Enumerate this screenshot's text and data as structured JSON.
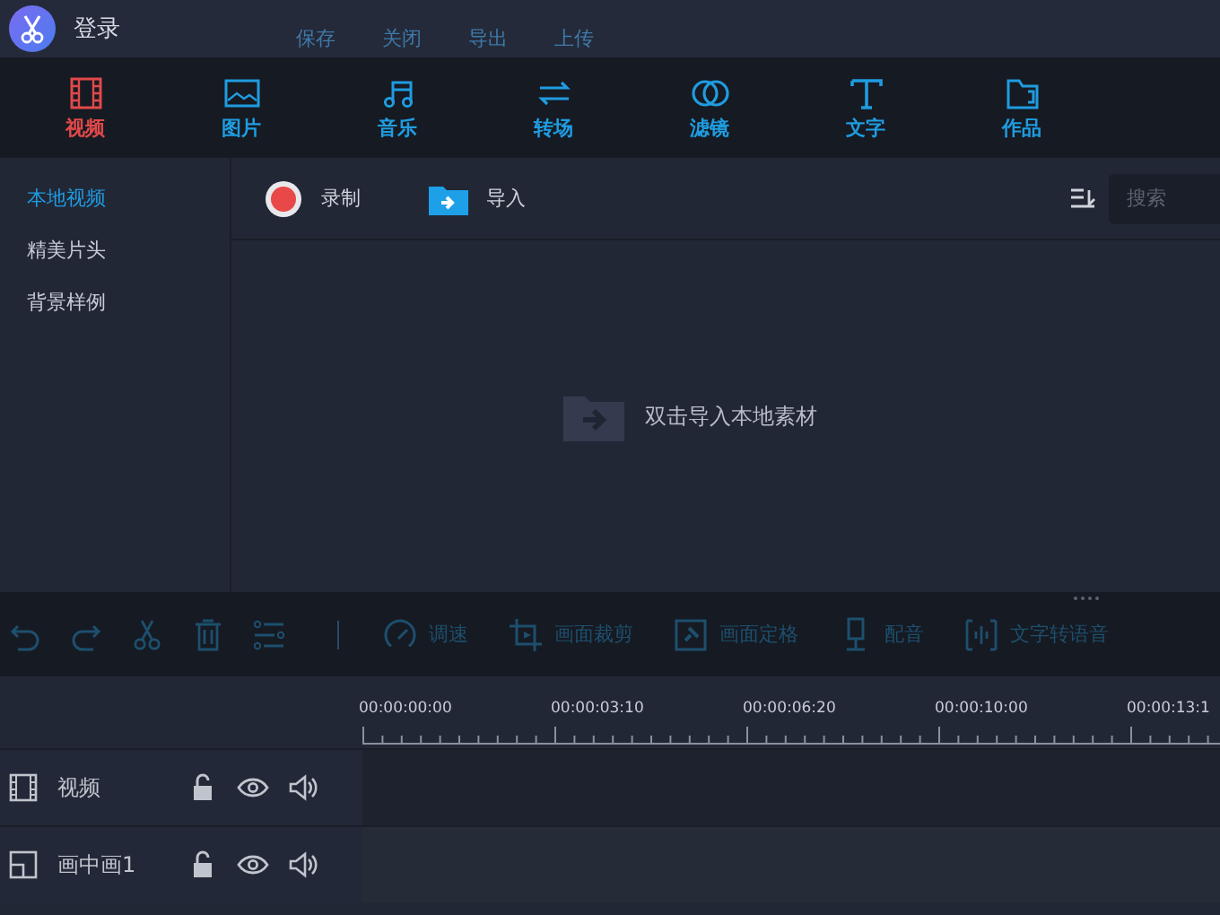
{
  "title_bar": {
    "login": "登录",
    "menu": [
      {
        "label": "保存",
        "disabled": true
      },
      {
        "label": "关闭",
        "disabled": true
      },
      {
        "label": "导出",
        "disabled": true
      },
      {
        "label": "上传",
        "disabled": true
      }
    ]
  },
  "tabs": [
    {
      "label": "视频",
      "kind": "film",
      "selected": true
    },
    {
      "label": "图片",
      "kind": "image",
      "selected": false
    },
    {
      "label": "音乐",
      "kind": "music",
      "selected": false
    },
    {
      "label": "转场",
      "kind": "swap",
      "selected": false
    },
    {
      "label": "滤镜",
      "kind": "rings",
      "selected": false
    },
    {
      "label": "文字",
      "kind": "text",
      "selected": false
    },
    {
      "label": "作品",
      "kind": "folder",
      "selected": false
    }
  ],
  "sidebar": {
    "items": [
      {
        "label": "本地视频",
        "selected": true
      },
      {
        "label": "精美片头",
        "selected": false
      },
      {
        "label": "背景样例",
        "selected": false
      }
    ]
  },
  "media_toolbar": {
    "record": "录制",
    "import": "导入",
    "search": {
      "placeholder": "搜索"
    }
  },
  "empty_hint": "双击导入本地素材",
  "edit_toolbar": [
    {
      "kind": "undo",
      "disabled": true
    },
    {
      "kind": "redo",
      "disabled": true
    },
    {
      "kind": "cut",
      "disabled": true
    },
    {
      "kind": "delete",
      "disabled": true
    },
    {
      "kind": "adjust",
      "disabled": true
    },
    {
      "kind": "divider"
    },
    {
      "kind": "speed",
      "label": "调速",
      "disabled": true
    },
    {
      "kind": "crop",
      "label": "画面裁剪",
      "disabled": true
    },
    {
      "kind": "freeze",
      "label": "画面定格",
      "disabled": true
    },
    {
      "kind": "dub",
      "label": "配音",
      "disabled": true
    },
    {
      "kind": "tts",
      "label": "文字转语音",
      "disabled": true
    }
  ],
  "timeline": {
    "ruler": [
      "00:00:00:00",
      "00:00:03:10",
      "00:00:06:20",
      "00:00:10:00",
      "00:00:13:1"
    ],
    "tracks": [
      {
        "kind": "video",
        "name": "视频",
        "locked": false,
        "visible": true,
        "muted": false
      },
      {
        "kind": "pip",
        "name": "画中画1",
        "locked": false,
        "visible": true,
        "muted": false
      }
    ]
  }
}
